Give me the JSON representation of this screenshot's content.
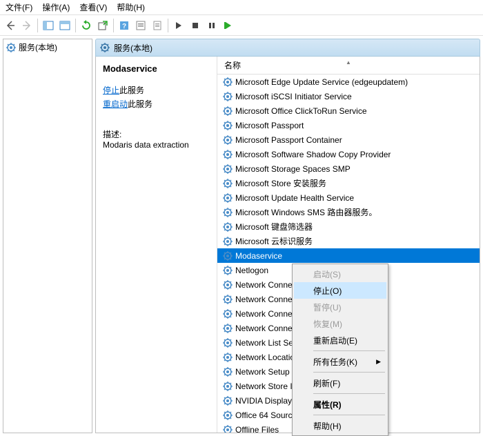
{
  "menu": {
    "file": "文件(F)",
    "action": "操作(A)",
    "view": "查看(V)",
    "help": "帮助(H)"
  },
  "tree": {
    "root": "服务(本地)"
  },
  "right_header": "服务(本地)",
  "detail": {
    "title": "Modaservice",
    "stop_link": "停止",
    "stop_suffix": "此服务",
    "restart_link": "重启动",
    "restart_suffix": "此服务",
    "desc_label": "描述:",
    "desc": "Modaris data extraction"
  },
  "list_header": "名称",
  "services": [
    "Microsoft Edge Update Service (edgeupdatem)",
    "Microsoft iSCSI Initiator Service",
    "Microsoft Office ClickToRun Service",
    "Microsoft Passport",
    "Microsoft Passport Container",
    "Microsoft Software Shadow Copy Provider",
    "Microsoft Storage Spaces SMP",
    "Microsoft Store 安装服务",
    "Microsoft Update Health Service",
    "Microsoft Windows SMS 路由器服务。",
    "Microsoft 键盘筛选器",
    "Microsoft 云标识服务",
    "Modaservice",
    "Netlogon",
    "Network Connected Devices Auto-Setup",
    "Network Connection Broker",
    "Network Connections",
    "Network Connectivity Assistant",
    "Network List Service",
    "Network Location Awareness",
    "Network Setup Service",
    "Network Store Interface Service",
    "NVIDIA Display Container LS",
    "Office 64 Source Engine",
    "Offline Files"
  ],
  "selected_index": 12,
  "ctx": {
    "start": "启动(S)",
    "stop": "停止(O)",
    "pause": "暂停(U)",
    "resume": "恢复(M)",
    "restart": "重新启动(E)",
    "all_tasks": "所有任务(K)",
    "refresh": "刷新(F)",
    "properties": "属性(R)",
    "help": "帮助(H)"
  }
}
